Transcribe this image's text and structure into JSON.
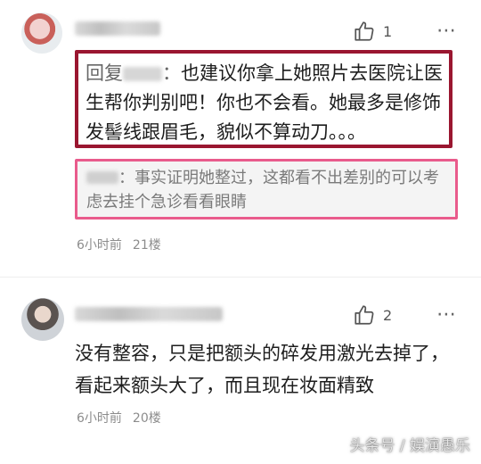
{
  "comments": [
    {
      "likes": "1",
      "reply_prefix": "回复",
      "reply_colon": "：",
      "reply_text": "也建议你拿上她照片去医院让医生帮你判别吧！你也不会看。她最多是修饰发髻线跟眉毛，貌似不算动刀。。。",
      "quoted_colon": "：",
      "quoted_text": "事实证明她整过，这都看不出差别的可以考虑去挂个急诊看看眼睛",
      "time": "6小时前",
      "floor": "21楼"
    },
    {
      "likes": "2",
      "text": "没有整容，只是把额头的碎发用激光去掉了，看起来额头大了，而且现在妆面精致",
      "time": "6小时前",
      "floor": "20楼"
    }
  ],
  "more_icon": "⋯",
  "watermark": "头条号 / 娱演愚乐",
  "colors": {
    "reply_border": "#9a1630",
    "quote_border": "#e95b8c"
  }
}
